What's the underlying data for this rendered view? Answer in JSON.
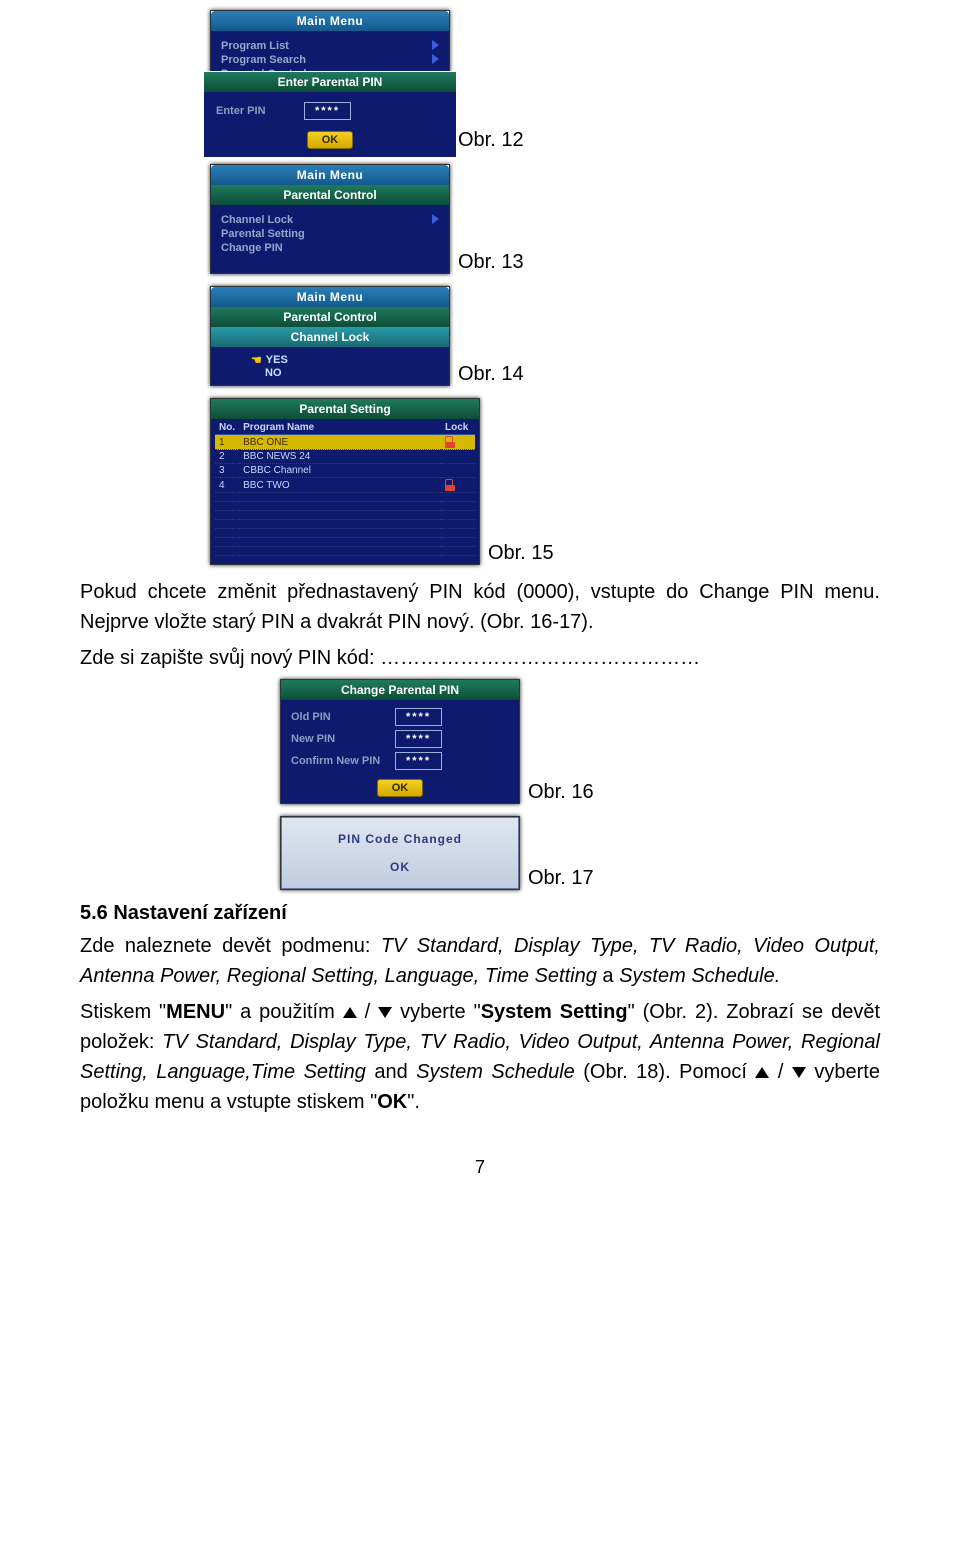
{
  "fig12": {
    "main_menu": "Main Menu",
    "items": [
      "Program List",
      "Program Search",
      "Parental Control"
    ],
    "modal_title": "Enter Parental PIN",
    "enter_pin": "Enter PIN",
    "pin_mask": "****",
    "ok": "OK"
  },
  "fig13": {
    "main_menu": "Main Menu",
    "sub": "Parental Control",
    "items": [
      "Channel Lock",
      "Parental Setting",
      "Change PIN"
    ]
  },
  "fig14": {
    "main_menu": "Main Menu",
    "sub": "Parental Control",
    "sub2": "Channel Lock",
    "yes": "YES",
    "no": "NO"
  },
  "fig15": {
    "title": "Parental Setting",
    "cols": [
      "No.",
      "Program Name",
      "Lock"
    ],
    "rows": [
      {
        "no": "1",
        "name": "BBC ONE",
        "lock": true
      },
      {
        "no": "2",
        "name": "BBC NEWS 24",
        "lock": false
      },
      {
        "no": "3",
        "name": "CBBC Channel",
        "lock": false
      },
      {
        "no": "4",
        "name": "BBC TWO",
        "lock": true
      }
    ]
  },
  "fig16": {
    "title": "Change Parental PIN",
    "old": "Old PIN",
    "new": "New PIN",
    "conf": "Confirm New PIN",
    "mask": "****",
    "ok": "OK"
  },
  "fig17": {
    "msg": "PIN Code Changed",
    "ok": "OK"
  },
  "labels": {
    "l12": "Obr. 12",
    "l13": "Obr. 13",
    "l14": "Obr. 14",
    "l15": "Obr. 15",
    "l16": "Obr. 16",
    "l17": "Obr. 17"
  },
  "text": {
    "p1a": "Pokud chcete změnit přednastavený PIN kód (0000), vstupte do Change PIN menu.",
    "p1b": "Nejprve vložte starý PIN a dvakrát PIN nový. (Obr. 16-17).",
    "p2": "Zde si zapište svůj nový PIN kód: …………………………………………",
    "sec": "5.6   Nastavení zařízení",
    "p3a": "Zde naleznete devět podmenu: ",
    "p3b": "TV Standard, Display Type, TV Radio, Video Output, Antenna Power, Regional Setting, Language, Time Setting ",
    "p3c": "a ",
    "p3d": "System Schedule.",
    "p4a": "Stiskem \"",
    "p4b": "MENU",
    "p4c": "\" a použitím ",
    "p4d": " / ",
    "p4e": " vyberte \"",
    "p4f": "System Setting",
    "p4g": "\" (Obr. 2). Zobrazí se devět položek: ",
    "p4h": "TV Standard, Display Type, TV Radio, Video Output, Antenna Power, Regional Setting, Language,Time Setting ",
    "p4i": "and ",
    "p4j": "System Schedule ",
    "p4k": "(Obr. 18). Pomocí ",
    "p4l": " / ",
    "p4m": " vyberte položku menu a vstupte stiskem \"",
    "p4n": "OK",
    "p4o": "\"."
  },
  "pagenum": "7"
}
